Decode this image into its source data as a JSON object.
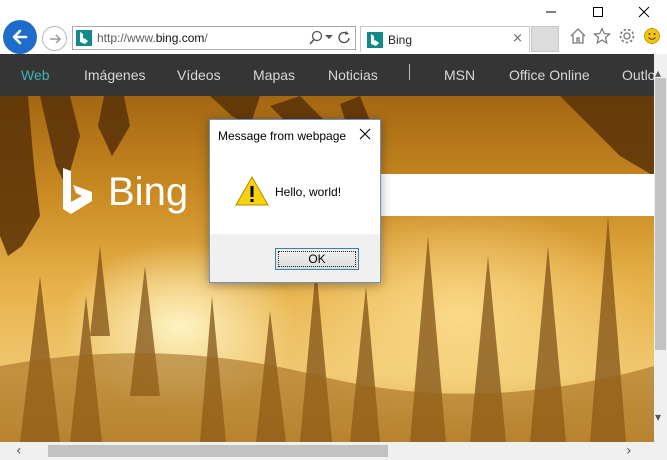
{
  "browser": {
    "address": {
      "prefix": "http://www.",
      "domain": "bing.com",
      "suffix": "/"
    },
    "tab_title": "Bing",
    "tab_close": "×",
    "icons": [
      "back-arrow-icon",
      "forward-arrow-icon",
      "search-icon",
      "refresh-icon",
      "home-icon",
      "star-icon",
      "gear-icon",
      "smiley-icon"
    ],
    "accent": "#1e6dcb"
  },
  "bing_nav": {
    "items": [
      "Web",
      "Imágenes",
      "Vídeos",
      "Mapas",
      "Noticias",
      "MSN",
      "Office Online",
      "Outlo"
    ],
    "active_index": 0,
    "active_color": "#3fb3b3"
  },
  "logo": {
    "word": "Bing"
  },
  "dialog": {
    "title": "Message from webpage",
    "message": "Hello, world!",
    "ok_label": "OK",
    "close_glyph": "✕"
  }
}
